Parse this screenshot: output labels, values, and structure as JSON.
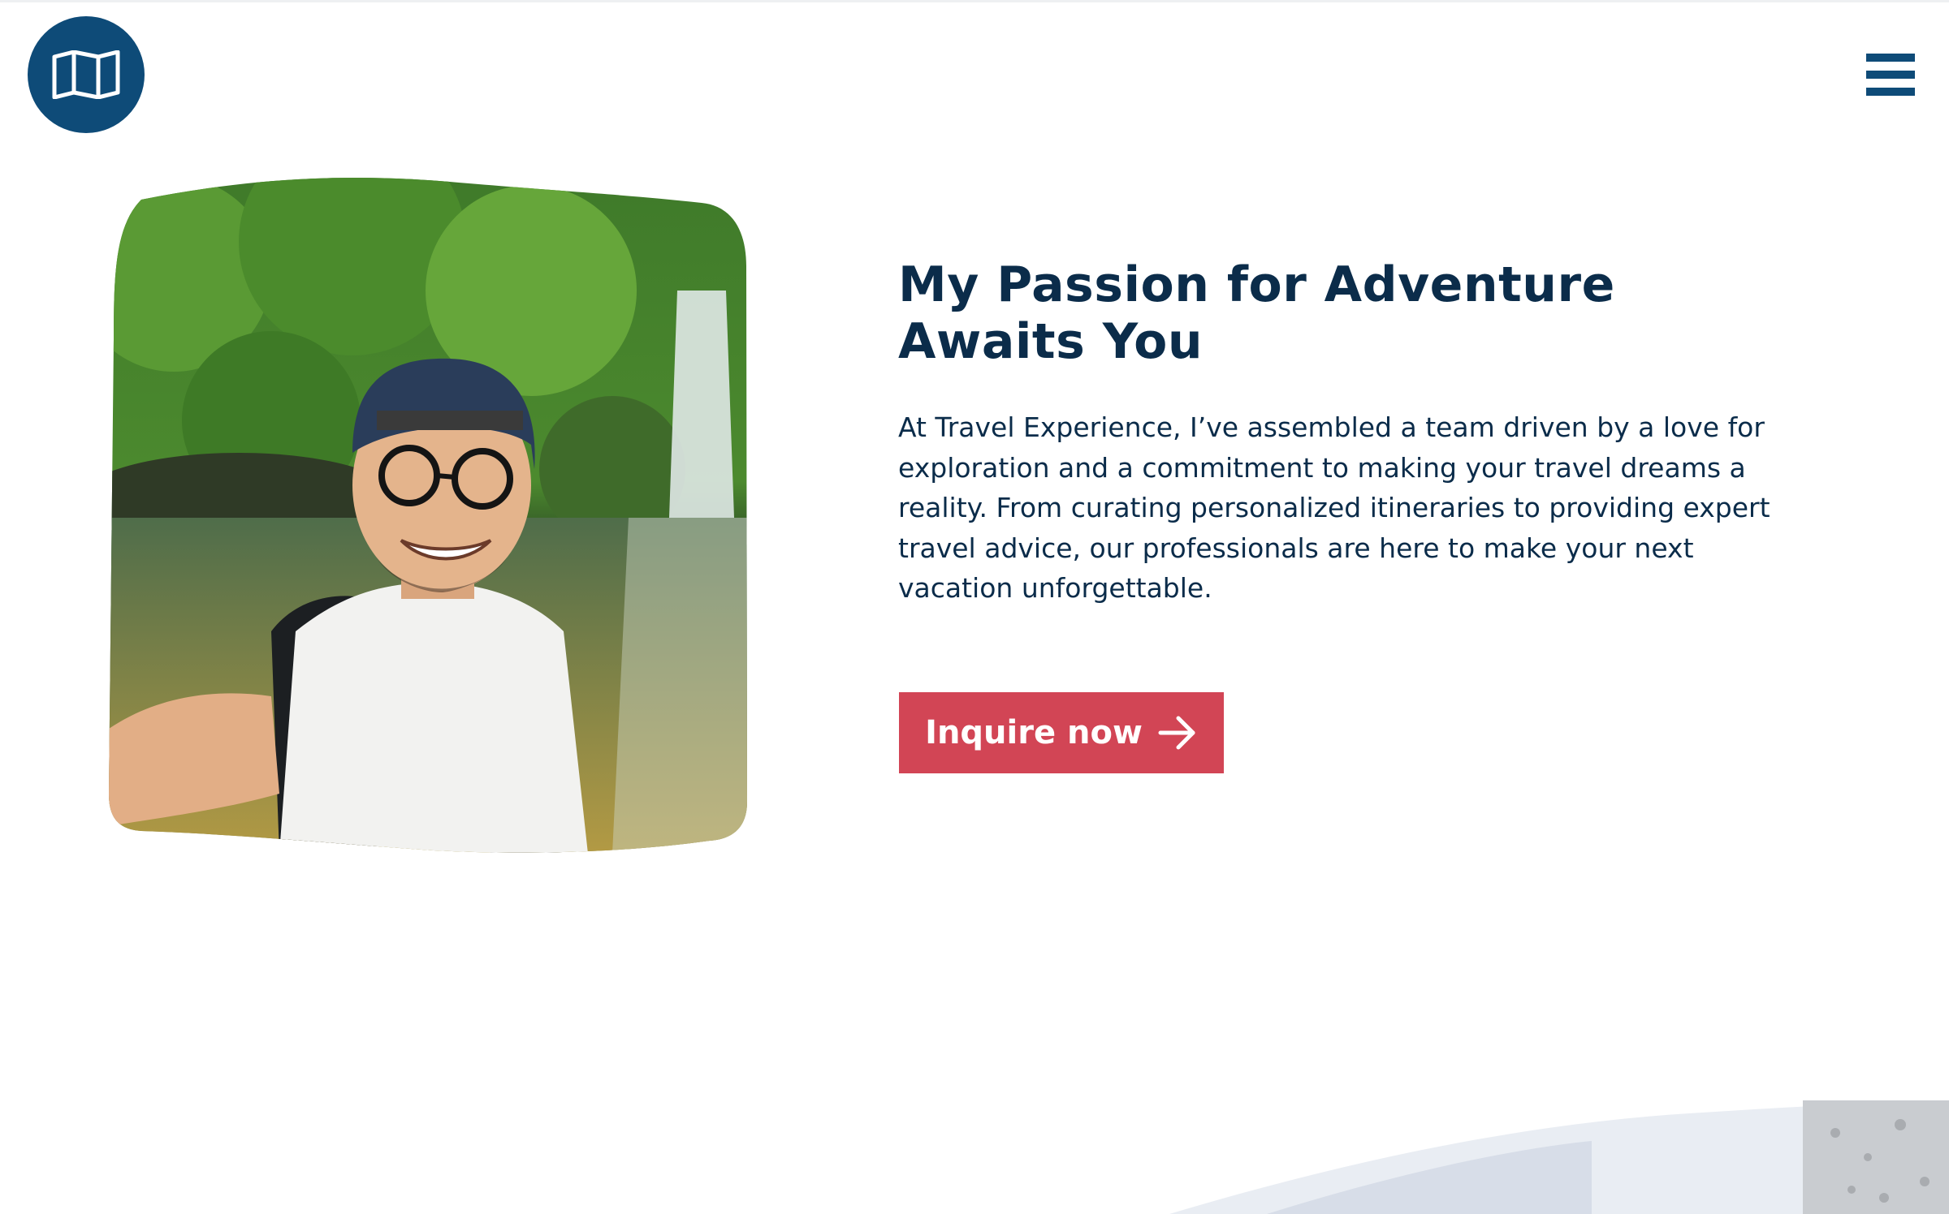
{
  "brand": {
    "logo_icon": "map-icon",
    "color": "#0e4b78"
  },
  "nav": {
    "menu_icon": "hamburger-icon"
  },
  "hero": {
    "image_alt": "Smiling traveler taking a selfie in front of a jungle waterfall",
    "title_line1": "My Passion for Adventure",
    "title_line2": "Awaits You",
    "body": "At Travel Experience, I’ve assembled a team driven by a love for exploration and a commitment to making your travel dreams a reality. From curating personalized itineraries to providing expert travel advice, our professionals are here to make your next vacation unforgettable.",
    "cta_label": "Inquire now",
    "cta_icon": "arrow-right-icon"
  },
  "colors": {
    "heading": "#0b2c4a",
    "accent": "#d24555",
    "brand": "#0e4b78"
  }
}
